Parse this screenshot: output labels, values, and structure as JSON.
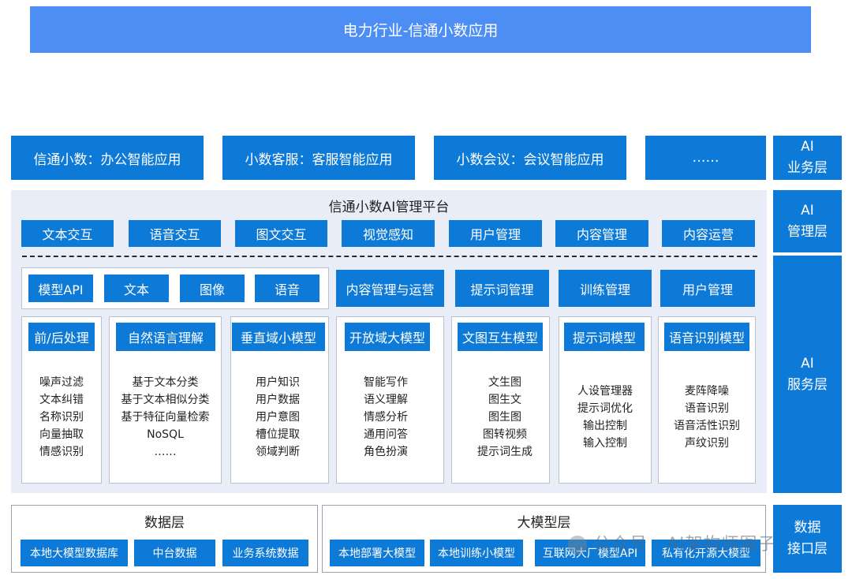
{
  "title": "电力行业-信通小数应用",
  "side_labels": {
    "business": [
      "AI",
      "业务层"
    ],
    "management": [
      "AI",
      "管理层"
    ],
    "service": [
      "AI",
      "服务层"
    ],
    "data": [
      "数据",
      "接口层"
    ]
  },
  "business_apps": [
    "信通小数：办公智能应用",
    "小数客服：客服智能应用",
    "小数会议：会议智能应用",
    "……"
  ],
  "management": {
    "title": "信通小数AI管理平台",
    "buttons": [
      "文本交互",
      "语音交互",
      "图文交互",
      "视觉感知",
      "用户管理",
      "内容管理",
      "内容运营"
    ]
  },
  "service": {
    "model_api_group": [
      "模型API",
      "文本",
      "图像",
      "语音"
    ],
    "top_buttons": [
      "内容管理与运营",
      "提示词管理",
      "训练管理",
      "用户管理"
    ],
    "columns": [
      {
        "label": "前/后处理",
        "items": [
          "噪声过滤",
          "文本纠错",
          "名称识别",
          "向量抽取",
          "情感识别"
        ]
      },
      {
        "label": "自然语言理解",
        "items": [
          "基于文本分类",
          "基于文本相似分类",
          "基于特征向量检索",
          "NoSQL",
          "……"
        ]
      },
      {
        "label": "垂直域小模型",
        "items": [
          "用户知识",
          "用户数据",
          "用户意图",
          "槽位提取",
          "领域判断"
        ]
      },
      {
        "label": "开放域大模型",
        "items": [
          "智能写作",
          "语义理解",
          "情感分析",
          "通用问答",
          "角色扮演"
        ]
      },
      {
        "label": "文图互生模型",
        "items": [
          "文生图",
          "图生文",
          "图生图",
          "图转视频",
          "提示词生成"
        ]
      },
      {
        "label": "提示词模型",
        "items": [
          "人设管理器",
          "提示词优化",
          "输出控制",
          "输入控制"
        ]
      },
      {
        "label": "语音识别模型",
        "items": [
          "麦阵降噪",
          "语音识别",
          "语音活性识别",
          "声纹识别"
        ]
      }
    ]
  },
  "data_layer": {
    "title": "数据层",
    "buttons": [
      "本地大模型数据库",
      "中台数据",
      "业务系统数据"
    ]
  },
  "model_layer": {
    "title": "大模型层",
    "buttons": [
      "本地部署大模型",
      "本地训练小模型",
      "互联网大厂模型API",
      "私有化开源大模型"
    ]
  },
  "watermark": "公众号 · AI架构师图子",
  "colors": {
    "primary": "#0e7ad8",
    "title_bar": "#4d8ef5",
    "panel_bg": "#e8edf8"
  }
}
